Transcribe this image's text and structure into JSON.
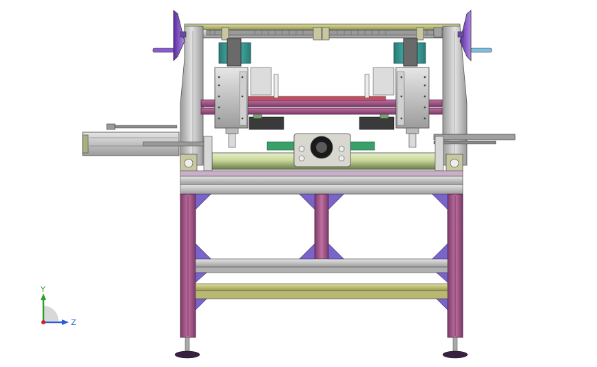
{
  "viewport": {
    "background": "#ffffff",
    "model_view": "front"
  },
  "colors": {
    "frame_magenta": "#b0608f",
    "frame_magenta_dark": "#6a2c56",
    "frame_grey": "#c8c8c8",
    "frame_grey_dark": "#7a7a7a",
    "gusset_purple": "#7a64c8",
    "olive": "#c8c870",
    "motor_teal": "#3aa7a2",
    "green_pad": "#3aa06a",
    "handwheel_purple": "#8a5ad0",
    "handle_blue": "#7fbfe0",
    "foot_dark": "#3a2040"
  },
  "triad": {
    "y_label": "Y",
    "z_label": "Z",
    "y_color": "#2aa02a",
    "z_color": "#2a5ad8",
    "origin_color": "#d02020"
  }
}
